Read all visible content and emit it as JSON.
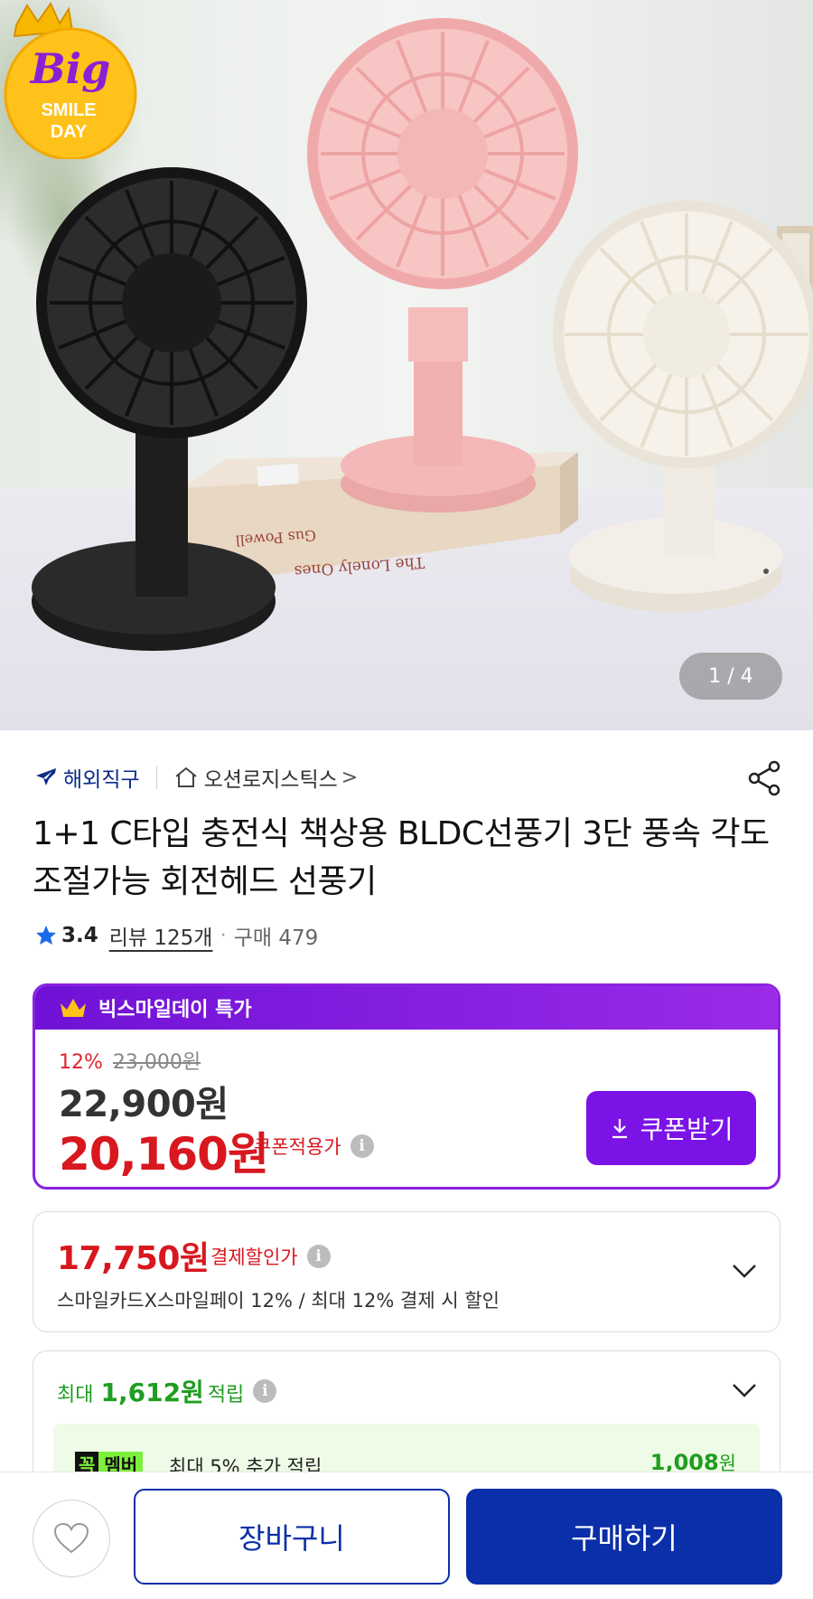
{
  "hero": {
    "page_counter": "1 / 4",
    "badge": {
      "line1": "Big",
      "line2": "SMILE",
      "line3": "DAY"
    },
    "book_text_1": "Gus Powell",
    "book_text_2": "The Lonely Ones"
  },
  "seller": {
    "overseas_label": "해외직구",
    "store_name": "오션로지스틱스",
    "chevron": ">"
  },
  "product": {
    "title": "1+1 C타입 충전식 책상용 BLDC선풍기 3단 풍속 각도조절가능 회전헤드 선풍기",
    "rating": "3.4",
    "reviews": "리뷰 125개",
    "dot": "·",
    "purchases": "구매 479"
  },
  "promo": {
    "header": "빅스마일데이 특가",
    "discount_pct": "12%",
    "original_price": "23,000원",
    "price": "22,900원",
    "coupon_price": "20,160원",
    "coupon_label": "쿠폰적용가",
    "coupon_button": "쿠폰받기"
  },
  "payment": {
    "price": "17,750원",
    "label": "결제할인가",
    "description": "스마일카드X스마일페이 12% / 최대 12% 결제 시 할인"
  },
  "points": {
    "prefix": "최대",
    "amount": "1,612원",
    "suffix": "적립",
    "member_tag_k": "꼭",
    "member_tag_m": "멤버",
    "member_text": "최대 5% 추가 적립",
    "member_amount": "1,008",
    "member_amount_unit": "원"
  },
  "bottom": {
    "cart_label": "장바구니",
    "buy_label": "구매하기"
  },
  "colors": {
    "purple": "#7b13e6",
    "red": "#d8171f",
    "green": "#1f9d1f",
    "navy": "#0b2fa8"
  }
}
